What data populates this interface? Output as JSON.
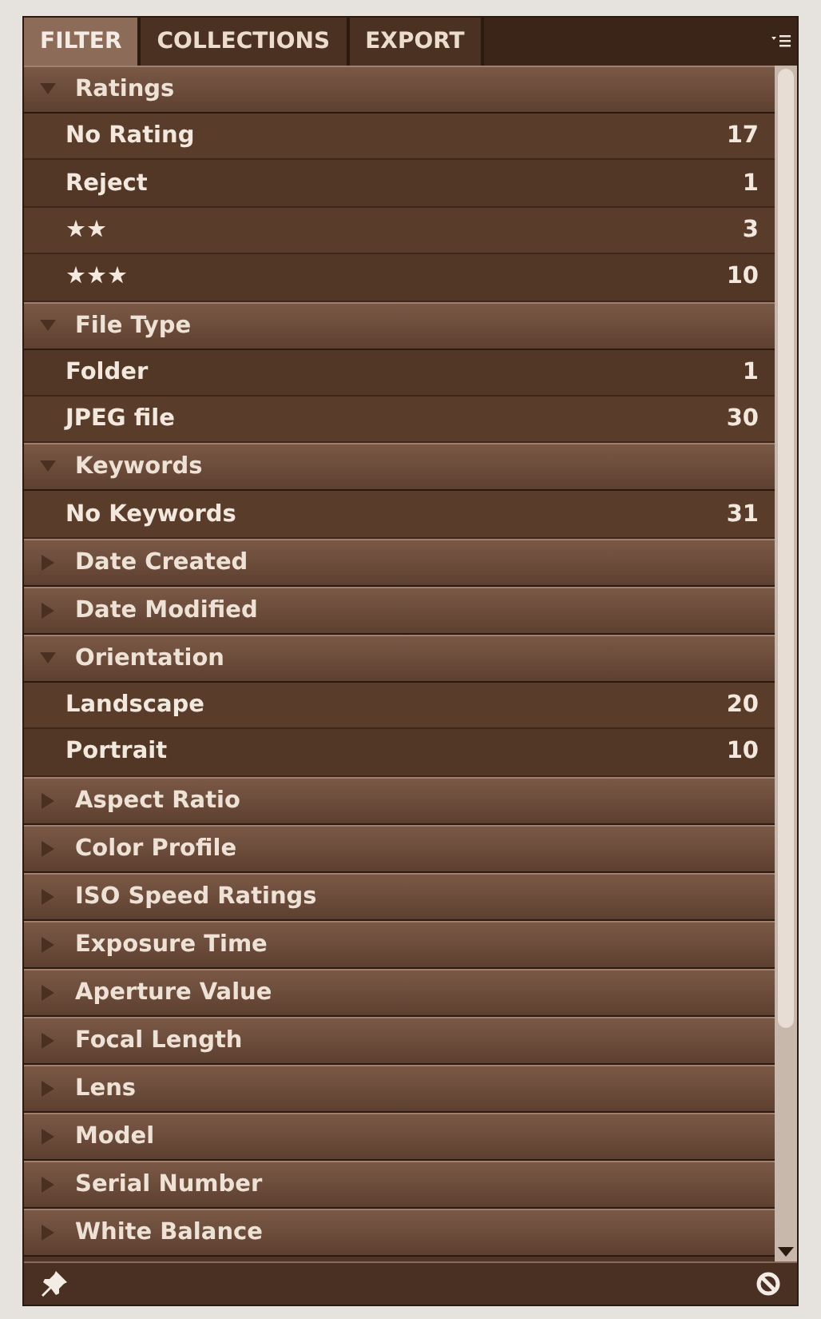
{
  "tabs": [
    {
      "label": "FILTER",
      "selected": true
    },
    {
      "label": "COLLECTIONS",
      "selected": false
    },
    {
      "label": "EXPORT",
      "selected": false
    }
  ],
  "sections": [
    {
      "title": "Ratings",
      "expanded": true,
      "items": [
        {
          "label": "No Rating",
          "count": "17"
        },
        {
          "label": "Reject",
          "count": "1"
        },
        {
          "label": "★★",
          "count": "3"
        },
        {
          "label": "★★★",
          "count": "10"
        }
      ]
    },
    {
      "title": "File Type",
      "expanded": true,
      "items": [
        {
          "label": "Folder",
          "count": "1"
        },
        {
          "label": "JPEG file",
          "count": "30"
        }
      ]
    },
    {
      "title": "Keywords",
      "expanded": true,
      "items": [
        {
          "label": "No Keywords",
          "count": "31"
        }
      ]
    },
    {
      "title": "Date Created",
      "expanded": false
    },
    {
      "title": "Date Modified",
      "expanded": false
    },
    {
      "title": "Orientation",
      "expanded": true,
      "items": [
        {
          "label": "Landscape",
          "count": "20"
        },
        {
          "label": "Portrait",
          "count": "10"
        }
      ]
    },
    {
      "title": "Aspect Ratio",
      "expanded": false
    },
    {
      "title": "Color Profile",
      "expanded": false
    },
    {
      "title": "ISO Speed Ratings",
      "expanded": false
    },
    {
      "title": "Exposure Time",
      "expanded": false
    },
    {
      "title": "Aperture Value",
      "expanded": false
    },
    {
      "title": "Focal Length",
      "expanded": false
    },
    {
      "title": "Lens",
      "expanded": false
    },
    {
      "title": "Model",
      "expanded": false
    },
    {
      "title": "Serial Number",
      "expanded": false
    },
    {
      "title": "White Balance",
      "expanded": false
    }
  ]
}
